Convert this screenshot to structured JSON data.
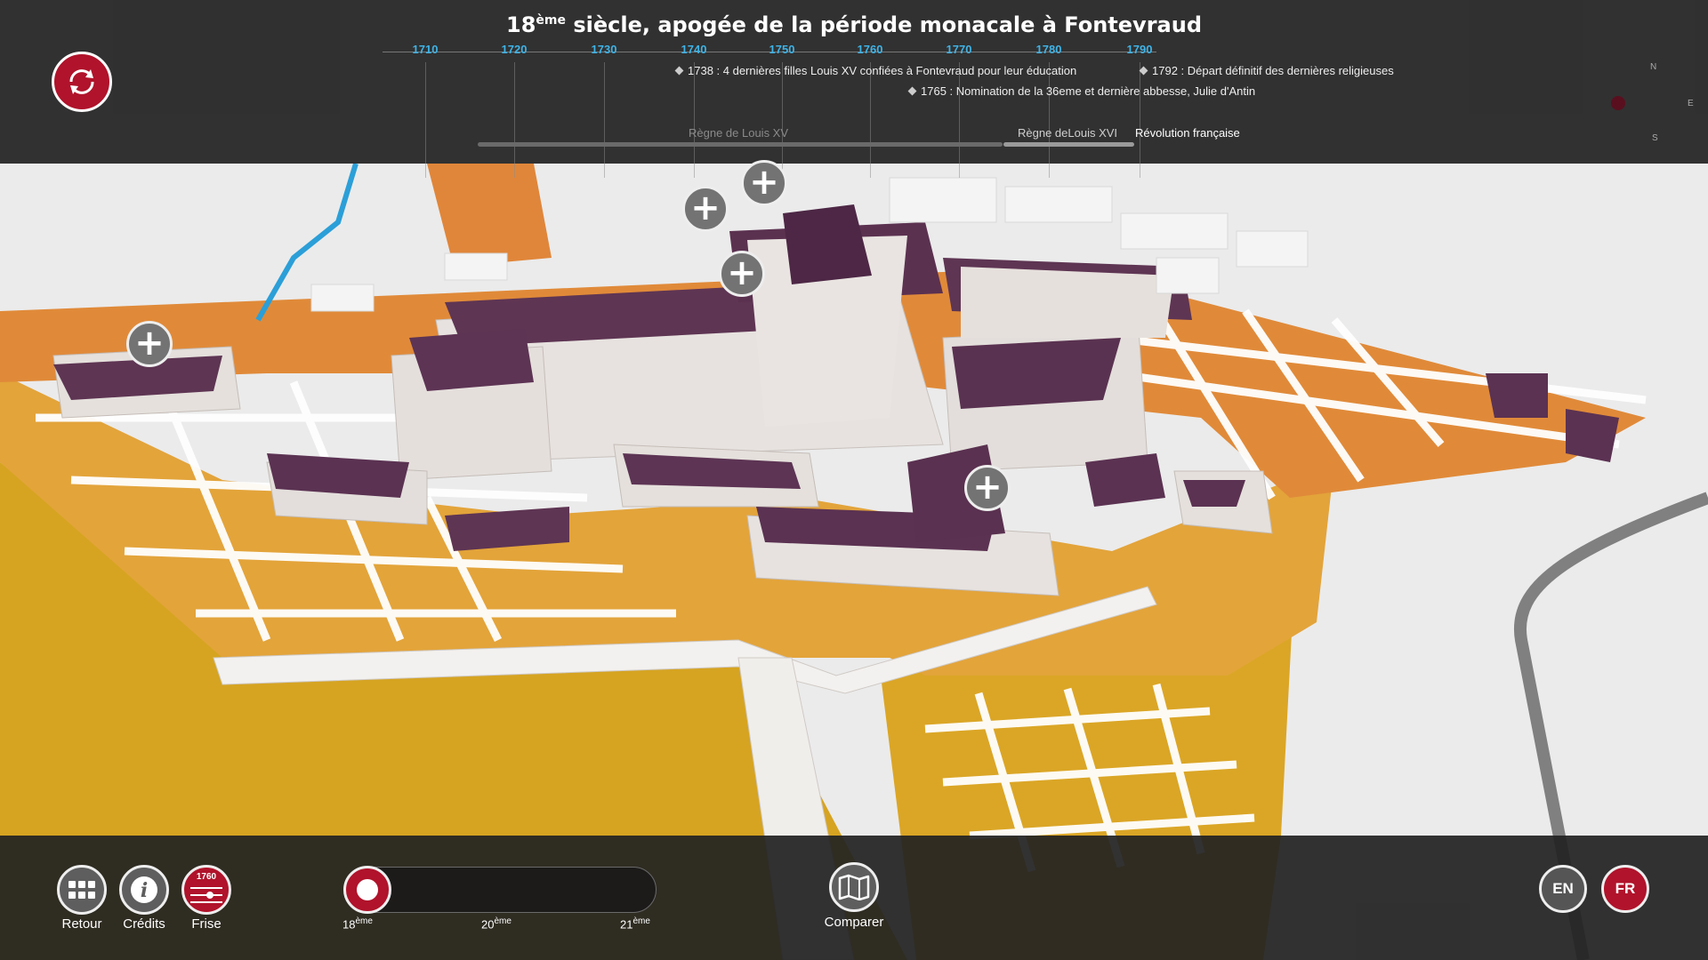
{
  "header": {
    "title_main": "18",
    "title_sup": "ème",
    "title_rest": " siècle, apogée de la période monacale à Fontevraud"
  },
  "timeline": {
    "years": [
      "1710",
      "1720",
      "1730",
      "1740",
      "1750",
      "1760",
      "1770",
      "1780",
      "1790"
    ],
    "events": [
      "1738 : 4 dernières filles Louis XV confiées à Fontevraud pour leur éducation",
      "1792 : Départ définitif des dernières religieuses",
      "1765 : Nomination de la 36eme et dernière abbesse, Julie d'Antin"
    ],
    "reigns": [
      "Règne de Louis XV",
      "Règne deLouis XVI",
      "Révolution française"
    ]
  },
  "compass": {
    "n": "N",
    "e": "E",
    "s": "S"
  },
  "plus_buttons": [
    "+",
    "+",
    "+",
    "+",
    "+"
  ],
  "footer": {
    "retour": "Retour",
    "credits": "Crédits",
    "frise": "Frise",
    "frise_year": "1760",
    "comparer": "Comparer",
    "centuries": [
      {
        "num": "18",
        "sup": "ème"
      },
      {
        "num": "20",
        "sup": "ème"
      },
      {
        "num": "21",
        "sup": "ème"
      }
    ],
    "lang_en": "EN",
    "lang_fr": "FR"
  },
  "colors": {
    "accent": "#b0132b",
    "timeline_year": "#3fb3e6",
    "roof": "#5e3553",
    "field_orange": "#e28c38",
    "field_gold": "#dca524"
  }
}
